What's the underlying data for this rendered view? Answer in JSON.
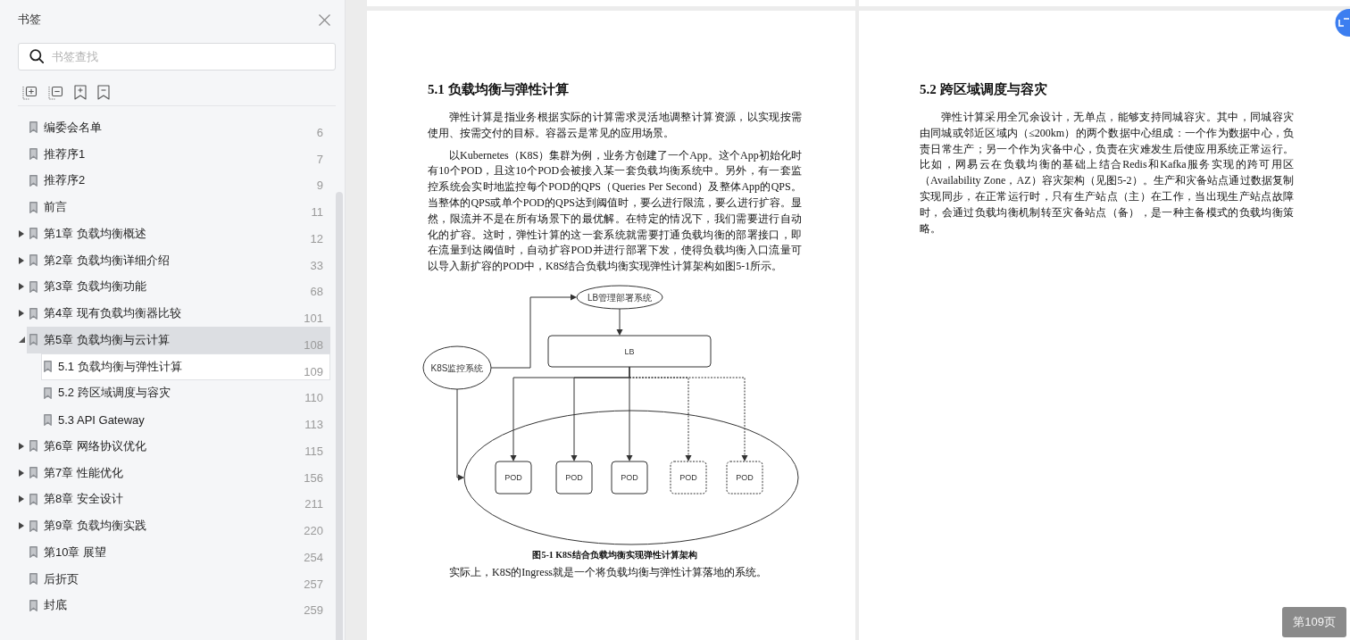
{
  "sidebar": {
    "title": "书签",
    "search": {
      "placeholder": "书签查找"
    },
    "bookmarks": [
      {
        "label": "编委会名单",
        "page": "6",
        "selected": false,
        "focused": false
      },
      {
        "label": "推荐序1",
        "page": "7",
        "selected": false,
        "focused": false
      },
      {
        "label": "推荐序2",
        "page": "9",
        "selected": false,
        "focused": false
      },
      {
        "label": "前言",
        "page": "11",
        "selected": false,
        "focused": false
      },
      {
        "label": "第1章 负载均衡概述",
        "page": "12",
        "selected": false,
        "focused": false,
        "expanded": false
      },
      {
        "label": "第2章 负载均衡详细介绍",
        "page": "33",
        "selected": false,
        "focused": false,
        "expanded": false
      },
      {
        "label": "第3章 负载均衡功能",
        "page": "68",
        "selected": false,
        "focused": false,
        "expanded": false
      },
      {
        "label": "第4章 现有负载均衡器比较",
        "page": "101",
        "selected": false,
        "focused": false,
        "expanded": false
      },
      {
        "label": "第5章 负载均衡与云计算",
        "page": "108",
        "selected": true,
        "focused": false,
        "expanded": true,
        "children": [
          {
            "label": "5.1 负载均衡与弹性计算",
            "page": "109",
            "selected": false,
            "focused": true
          },
          {
            "label": "5.2 跨区域调度与容灾",
            "page": "110",
            "selected": false,
            "focused": false
          },
          {
            "label": "5.3 API Gateway",
            "page": "113",
            "selected": false,
            "focused": false
          }
        ]
      },
      {
        "label": "第6章 网络协议优化",
        "page": "115",
        "selected": false,
        "focused": false,
        "expanded": false
      },
      {
        "label": "第7章 性能优化",
        "page": "156",
        "selected": false,
        "focused": false,
        "expanded": false
      },
      {
        "label": "第8章 安全设计",
        "page": "211",
        "selected": false,
        "focused": false,
        "expanded": false
      },
      {
        "label": "第9章 负载均衡实践",
        "page": "220",
        "selected": false,
        "focused": false,
        "expanded": false
      },
      {
        "label": "第10章 展望",
        "page": "254",
        "selected": false,
        "focused": false
      },
      {
        "label": "后折页",
        "page": "257",
        "selected": false,
        "focused": false
      },
      {
        "label": "封底",
        "page": "259",
        "selected": false,
        "focused": false
      }
    ]
  },
  "pages": [
    {
      "blocks": [
        {
          "kind": "heading",
          "text": "5.1 负载均衡与弹性计算"
        },
        {
          "kind": "paragraph",
          "text": "弹性计算是指业务根据实际的计算需求灵活地调整计算资源，以实现按需使用、按需交付的目标。容器云是常见的应用场景。"
        },
        {
          "kind": "paragraph",
          "text": "以Kubernetes（K8S）集群为例，业务方创建了一个App。这个App初始化时有10个POD，且这10个POD会被接入某一套负载均衡系统中。另外，有一套监控系统会实时地监控每个POD的QPS（Queries Per Second）及整体App的QPS。当整体的QPS或单个POD的QPS达到阈值时，要么进行限流，要么进行扩容。显然，限流并不是在所有场景下的最优解。在特定的情况下，我们需要进行自动化的扩容。这时，弹性计算的这一套系统就需要打通负载均衡的部署接口，即在流量到达阈值时，自动扩容POD并进行部署下发，使得负载均衡入口流量可以导入新扩容的POD中，K8S结合负载均衡实现弹性计算架构如图5-1所示。"
        },
        {
          "kind": "figure",
          "nodes": [
            {
              "kind": "ellipse",
              "label": "LB管理部署系统"
            },
            {
              "kind": "box",
              "label": "LB"
            },
            {
              "kind": "ellipse",
              "label": "K8S监控系统"
            }
          ],
          "pods": [
            {
              "label": "POD",
              "dashed": false
            },
            {
              "label": "POD",
              "dashed": false
            },
            {
              "label": "POD",
              "dashed": false
            },
            {
              "label": "POD",
              "dashed": true
            },
            {
              "label": "POD",
              "dashed": true
            }
          ]
        },
        {
          "kind": "caption",
          "text": "图5-1 K8S结合负载均衡实现弹性计算架构"
        },
        {
          "kind": "paragraph",
          "text": "实际上，K8S的Ingress就是一个将负载均衡与弹性计算落地的系统。"
        }
      ]
    },
    {
      "blocks": [
        {
          "kind": "heading",
          "text": "5.2 跨区域调度与容灾"
        },
        {
          "kind": "paragraph",
          "text": "弹性计算采用全冗余设计，无单点，能够支持同城容灾。其中，同城容灾由同城或邻近区域内（≤200km）的两个数据中心组成：一个作为数据中心，负责日常生产；另一个作为灾备中心，负责在灾难发生后使应用系统正常运行。比如，网易云在负载均衡的基础上结合Redis和Kafka服务实现的跨可用区（Availability Zone，AZ）容灾架构（见图5-2）。生产和灾备站点通过数据复制实现同步，在正常运行时，只有生产站点（主）在工作，当出现生产站点故障时，会通过负载均衡机制转至灾备站点（备），是一种主备模式的负载均衡策略。"
        }
      ]
    }
  ],
  "page_indicator": "第109页"
}
